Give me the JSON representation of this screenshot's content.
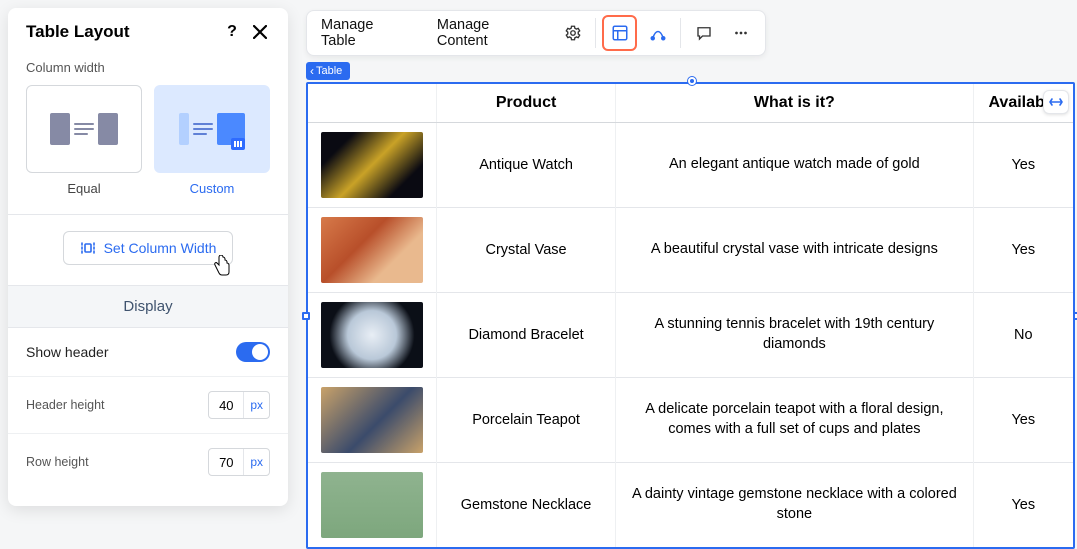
{
  "sidebar": {
    "title": "Table Layout",
    "column_width_label": "Column width",
    "options": {
      "equal": "Equal",
      "custom": "Custom"
    },
    "set_column_width": "Set Column Width",
    "display_heading": "Display",
    "show_header_label": "Show header",
    "show_header_on": true,
    "header_height_label": "Header height",
    "header_height_value": "40",
    "row_height_label": "Row height",
    "row_height_value": "70",
    "unit": "px"
  },
  "toolbar": {
    "manage_table": "Manage Table",
    "manage_content": "Manage Content"
  },
  "breadcrumb": "Table",
  "table": {
    "headers": {
      "image": "",
      "product": "Product",
      "what": "What is it?",
      "available": "Available"
    },
    "rows": [
      {
        "product": "Antique Watch",
        "desc": "An elegant antique watch made of gold",
        "available": "Yes",
        "thumb_bg": "linear-gradient(135deg,#0a0a12 20%,#c9a227 50%,#0a0a12 80%)"
      },
      {
        "product": "Crystal Vase",
        "desc": "A beautiful crystal vase with intricate designs",
        "available": "Yes",
        "thumb_bg": "linear-gradient(135deg,#d77a4a 0%,#b84f2a 40%,#e9b98e 70%)"
      },
      {
        "product": "Diamond Bracelet",
        "desc": "A stunning tennis bracelet with 19th century diamonds",
        "available": "No",
        "thumb_bg": "radial-gradient(circle at 50% 50%,#e8eef5 0%,#b9c8d8 40%,#0b0f17 70%)"
      },
      {
        "product": "Porcelain Teapot",
        "desc": "A delicate porcelain teapot with a floral design, comes with a full set of cups and plates",
        "available": "Yes",
        "thumb_bg": "linear-gradient(135deg,#c9a26a 0%,#3b4b6b 55%,#c9a26a 100%)"
      },
      {
        "product": "Gemstone Necklace",
        "desc": "A dainty vintage gemstone necklace with a colored stone",
        "available": "Yes",
        "thumb_bg": "linear-gradient(180deg,#8fb38f 0%,#7da77d 100%)"
      }
    ]
  }
}
